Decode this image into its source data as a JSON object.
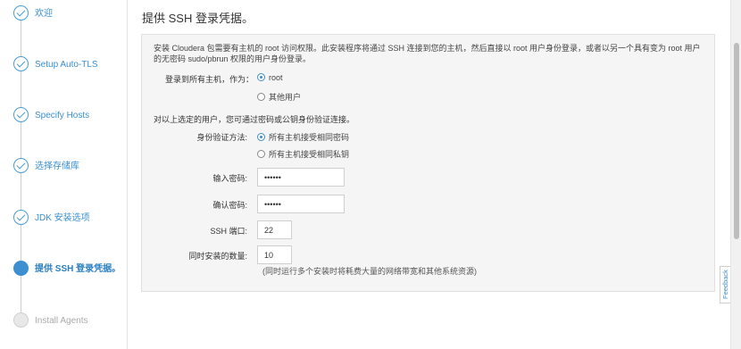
{
  "steps": [
    {
      "label": "欢迎",
      "state": "done"
    },
    {
      "label": "Setup Auto-TLS",
      "state": "done"
    },
    {
      "label": "Specify Hosts",
      "state": "done"
    },
    {
      "label": "选择存储库",
      "state": "done"
    },
    {
      "label": "JDK 安装选项",
      "state": "done"
    },
    {
      "label": "提供 SSH 登录凭据。",
      "state": "current"
    },
    {
      "label": "Install Agents",
      "state": "pending"
    }
  ],
  "main": {
    "title": "提供 SSH 登录凭据。",
    "intro": "安装 Cloudera 包需要有主机的 root 访问权限。此安装程序将通过 SSH 连接到您的主机，然后直接以 root 用户身份登录，或者以另一个具有变为 root 用户的无密码 sudo/pbrun 权限的用户身份登录。",
    "login_label": "登录到所有主机，作为：",
    "login_options": [
      {
        "label": "root",
        "selected": true
      },
      {
        "label": "其他用户",
        "selected": false
      }
    ],
    "auth_note": "对以上选定的用户，您可通过密码或公钥身份验证连接。",
    "auth_label": "身份验证方法:",
    "auth_options": [
      {
        "label": "所有主机接受相同密码",
        "selected": true
      },
      {
        "label": "所有主机接受相同私钥",
        "selected": false
      }
    ],
    "password_label": "输入密码:",
    "password_value": "••••••",
    "confirm_label": "确认密码:",
    "confirm_value": "••••••",
    "ssh_port_label": "SSH 端口:",
    "ssh_port_value": "22",
    "concurrent_label": "同时安装的数量:",
    "concurrent_value": "10",
    "concurrent_hint": "(同时运行多个安装时将耗费大量的网络带宽和其他系统资源)"
  },
  "feedback_label": "Feedback",
  "colors": {
    "accent": "#3c8fd0",
    "panel": "#f5f5f5"
  }
}
